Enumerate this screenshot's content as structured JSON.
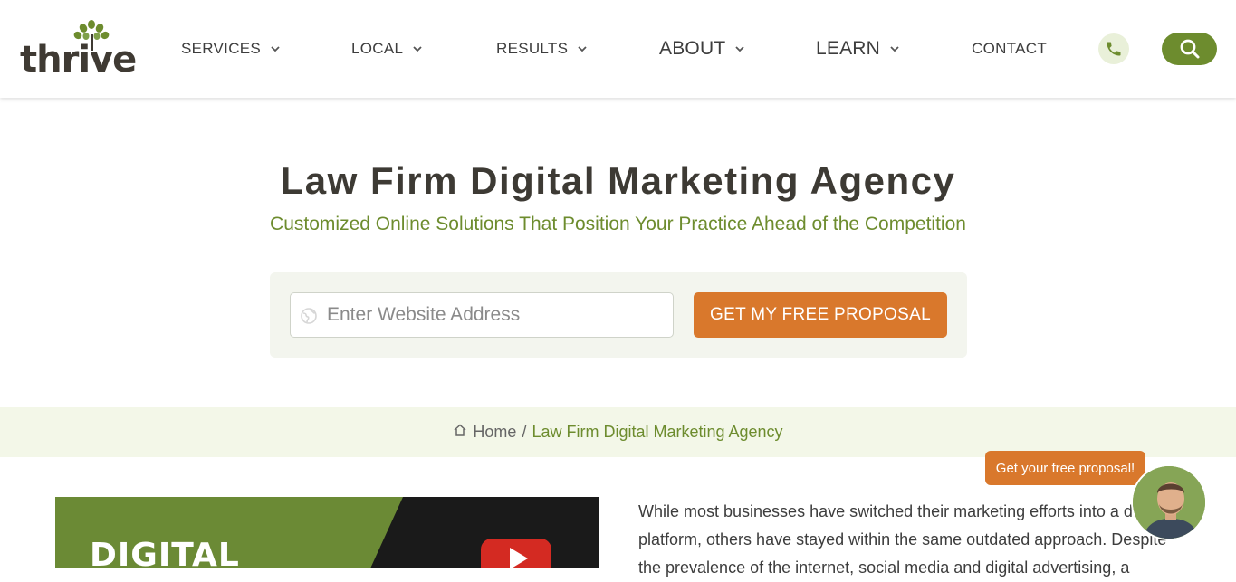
{
  "header": {
    "logo_text": "thrive",
    "nav": [
      {
        "label": "SERVICES",
        "icon": "chevron-down-icon"
      },
      {
        "label": "LOCAL",
        "icon": "chevron-down-icon"
      },
      {
        "label": "RESULTS",
        "icon": "chevron-down-icon"
      },
      {
        "label": "ABOUT",
        "icon": "chevron-down-icon"
      },
      {
        "label": "LEARN",
        "icon": "chevron-down-icon"
      },
      {
        "label": "CONTACT"
      }
    ],
    "phone_icon": "phone-icon",
    "search_icon": "search-icon"
  },
  "hero": {
    "title": "Law Firm Digital Marketing Agency",
    "subtitle": "Customized Online Solutions That Position Your Practice Ahead of the Competition",
    "input_placeholder": "Enter Website Address",
    "input_icon": "globe-icon",
    "cta_label": "GET MY FREE PROPOSAL"
  },
  "breadcrumb": {
    "home_icon": "home-icon",
    "home_label": "Home",
    "separator": "/",
    "current": "Law Firm Digital Marketing Agency"
  },
  "content": {
    "image_text": "DIGITAL",
    "paragraph": "While most businesses have switched their marketing efforts into a digital platform, others have stayed within the same outdated approach. Despite the prevalence of the internet, social media and digital advertising, a"
  },
  "chat": {
    "bubble_label": "Get your free proposal!"
  },
  "colors": {
    "brand_green": "#6d8c2e",
    "cta_orange": "#d9782c",
    "breadcrumb_bg": "#f3f7e8"
  }
}
